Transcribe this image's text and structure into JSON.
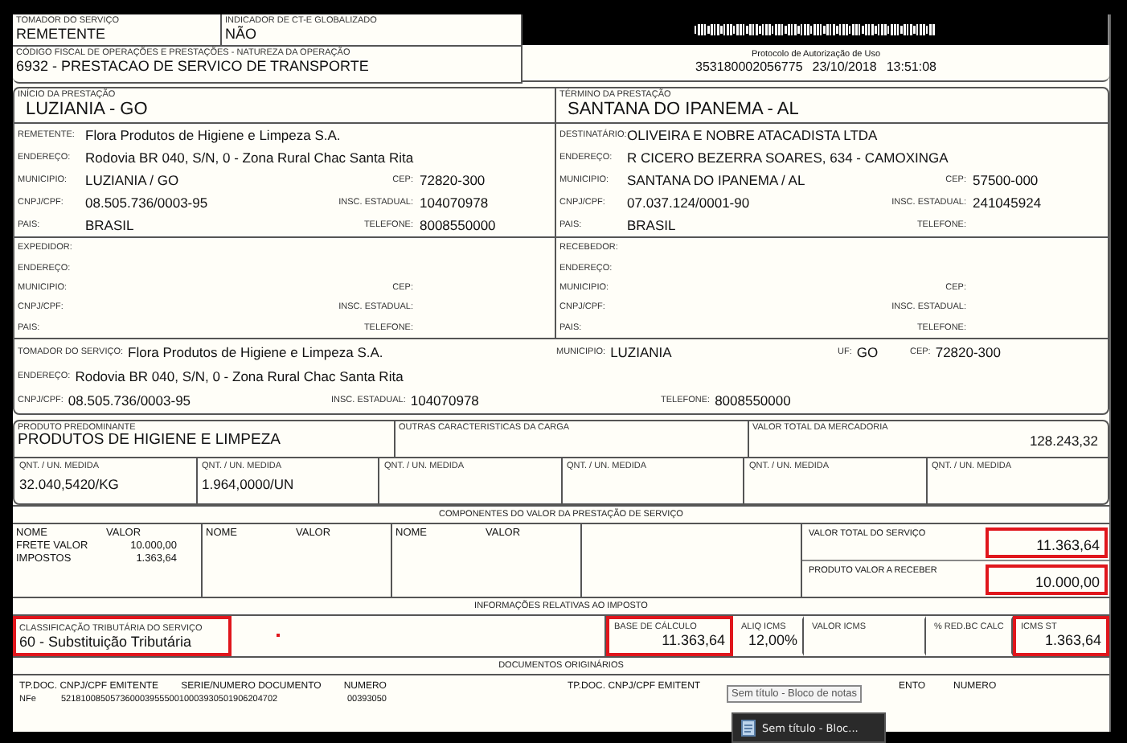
{
  "header": {
    "cells": [
      {
        "label": "TOMADOR DO SERVIÇO",
        "value": "REMETENTE"
      },
      {
        "label": "INDICADOR DE CT-E GLOBALIZADO",
        "value": "NÃO"
      }
    ],
    "cfop": {
      "label": "CÓDIGO FISCAL DE OPERAÇÕES E PRESTAÇÕES - NATUREZA DA OPERAÇÃO",
      "value": "6932 - PRESTACAO DE SERVICO DE TRANSPORTE"
    },
    "protocol": {
      "label": "Protocolo de Autorização de Uso",
      "number": "353180002056775",
      "date": "23/10/2018",
      "time": "13:51:08"
    }
  },
  "route": [
    {
      "label": "INÍCIO DA PRESTAÇÃO",
      "value": "LUZIANIA - GO"
    },
    {
      "label": "TÉRMINO DA PRESTAÇÃO",
      "value": "SANTANA DO IPANEMA - AL"
    }
  ],
  "party_rows": [
    {
      "left": {
        "lines": [
          {
            "label": "REMETENTE:",
            "value": "Flora Produtos de Higiene e Limpeza S.A."
          },
          {
            "label": "ENDEREÇO:",
            "value": "Rodovia BR 040, S/N, 0 - Zona Rural  Chac Santa Rita"
          },
          {
            "label": "MUNICIPIO:",
            "value": "LUZIANIA / GO",
            "extra": {
              "label": "CEP:",
              "value": "72820-300"
            }
          },
          {
            "label": "CNPJ/CPF:",
            "value": "08.505.736/0003-95",
            "extra": {
              "label": "INSC. ESTADUAL:",
              "value": "104070978"
            }
          },
          {
            "label": "PAIS:",
            "value": "BRASIL",
            "extra": {
              "label": "TELEFONE:",
              "value": "8008550000"
            }
          }
        ]
      },
      "right": {
        "lines": [
          {
            "label": "DESTINATÁRIO:",
            "value": "OLIVEIRA E NOBRE ATACADISTA LTDA"
          },
          {
            "label": "ENDEREÇO:",
            "value": "R CICERO BEZERRA SOARES, 634 - CAMOXINGA"
          },
          {
            "label": "MUNICIPIO:",
            "value": "SANTANA DO IPANEMA / AL",
            "extra": {
              "label": "CEP:",
              "value": "57500-000"
            }
          },
          {
            "label": "CNPJ/CPF:",
            "value": "07.037.124/0001-90",
            "extra": {
              "label": "INSC. ESTADUAL:",
              "value": "241045924"
            }
          },
          {
            "label": "PAIS:",
            "value": "BRASIL",
            "extra": {
              "label": "TELEFONE:"
            }
          }
        ]
      }
    },
    {
      "left": {
        "lines": [
          {
            "label": "EXPEDIDOR:"
          },
          {
            "label": "ENDEREÇO:"
          },
          {
            "label": "MUNICIPIO:",
            "extra": {
              "label": "CEP:"
            }
          },
          {
            "label": "CNPJ/CPF:",
            "extra": {
              "label": "INSC. ESTADUAL:"
            }
          },
          {
            "label": "PAIS:",
            "extra": {
              "label": "TELEFONE:"
            }
          }
        ]
      },
      "right": {
        "lines": [
          {
            "label": "RECEBEDOR:"
          },
          {
            "label": "ENDEREÇO:"
          },
          {
            "label": "MUNICIPIO:",
            "extra": {
              "label": "CEP:"
            }
          },
          {
            "label": "CNPJ/CPF:",
            "extra": {
              "label": "INSC. ESTADUAL:"
            }
          },
          {
            "label": "PAIS:",
            "extra": {
              "label": "TELEFONE:"
            }
          }
        ]
      }
    }
  ],
  "tomador": {
    "lines": [
      {
        "fields": [
          {
            "label": "TOMADOR DO SERVIÇO:",
            "value": "Flora Produtos de Higiene e Limpeza S.A."
          },
          {
            "label": "MUNICIPIO:",
            "value": "LUZIANIA"
          },
          {
            "label": "UF:",
            "value": "GO"
          },
          {
            "label": "CEP:",
            "value": "72820-300"
          }
        ]
      },
      {
        "fields": [
          {
            "label": "ENDEREÇO:",
            "value": "Rodovia BR 040, S/N, 0 - Zona Rural  Chac Santa Rita"
          }
        ]
      },
      {
        "fields": [
          {
            "label": "CNPJ/CPF:",
            "value": "08.505.736/0003-95"
          },
          {
            "label": "INSC. ESTADUAL:",
            "value": "104070978"
          },
          {
            "label": "TELEFONE:",
            "value": "8008550000"
          }
        ]
      }
    ]
  },
  "cargo": {
    "product": {
      "label": "PRODUTO PREDOMINANTE",
      "value": "PRODUTOS DE HIGIENE E LIMPEZA"
    },
    "other": {
      "label": "OUTRAS CARACTERISTICAS DA CARGA"
    },
    "total": {
      "label": "VALOR TOTAL DA MERCADORIA",
      "value": "128.243,32"
    },
    "quantities": [
      {
        "label": "QNT. / UN. MEDIDA",
        "value": "32.040,5420/KG"
      },
      {
        "label": "QNT. / UN. MEDIDA",
        "value": "1.964,0000/UN"
      },
      {
        "label": "QNT. / UN. MEDIDA"
      },
      {
        "label": "QNT. / UN. MEDIDA"
      },
      {
        "label": "QNT. / UN. MEDIDA"
      },
      {
        "label": "QNT. / UN. MEDIDA"
      }
    ]
  },
  "components": {
    "title": "COMPONENTES DO VALOR DA PRESTAÇÃO DE SERVIÇO",
    "columns": [
      {
        "name_header": "NOME",
        "value_header": "VALOR",
        "items": [
          {
            "name": "FRETE VALOR",
            "value": "10.000,00"
          },
          {
            "name": "IMPOSTOS",
            "value": "1.363,64"
          }
        ]
      },
      {
        "name_header": "NOME",
        "value_header": "VALOR"
      },
      {
        "name_header": "NOME",
        "value_header": "VALOR"
      }
    ],
    "totals": [
      {
        "label": "VALOR TOTAL DO SERVIÇO",
        "value": "11.363,64",
        "highlighted": true
      },
      {
        "label": "PRODUTO VALOR A RECEBER",
        "value": "10.000,00",
        "highlighted": true
      }
    ]
  },
  "tax": {
    "title": "INFORMAÇÕES RELATIVAS AO IMPOSTO",
    "classification": {
      "label": "CLASSIFICAÇÃO TRIBUTÁRIA DO SERVIÇO",
      "value": "60 - Substituição Tributária",
      "highlighted": true
    },
    "cells": [
      {
        "label": "BASE DE CÁLCULO",
        "value": "11.363,64",
        "highlighted": true
      },
      {
        "label": "ALIQ ICMS",
        "value": "12,00%",
        "highlighted": false
      },
      {
        "label": "VALOR ICMS",
        "highlighted": false
      },
      {
        "label": "% RED.BC CALC",
        "highlighted": false
      },
      {
        "label": "ICMS ST",
        "value": "1.363,64",
        "highlighted": true
      }
    ]
  },
  "documents": {
    "title": "DOCUMENTOS ORIGINÁRIOS",
    "left": {
      "headers": [
        "TP.DOC. CNPJ/CPF EMITENTE",
        "SERIE/NUMERO DOCUMENTO",
        "NUMERO"
      ],
      "rows": [
        [
          "NFe",
          "52181008505736000395550010003930501906204702",
          "00393050"
        ]
      ]
    },
    "right": {
      "headers": [
        "TP.DOC. CNPJ/CPF EMITENT",
        "ENTO",
        "NUMERO"
      ]
    }
  },
  "taskbar": {
    "button": "Sem título - Bloc...",
    "tooltip": "Sem título - Bloco de notas"
  }
}
